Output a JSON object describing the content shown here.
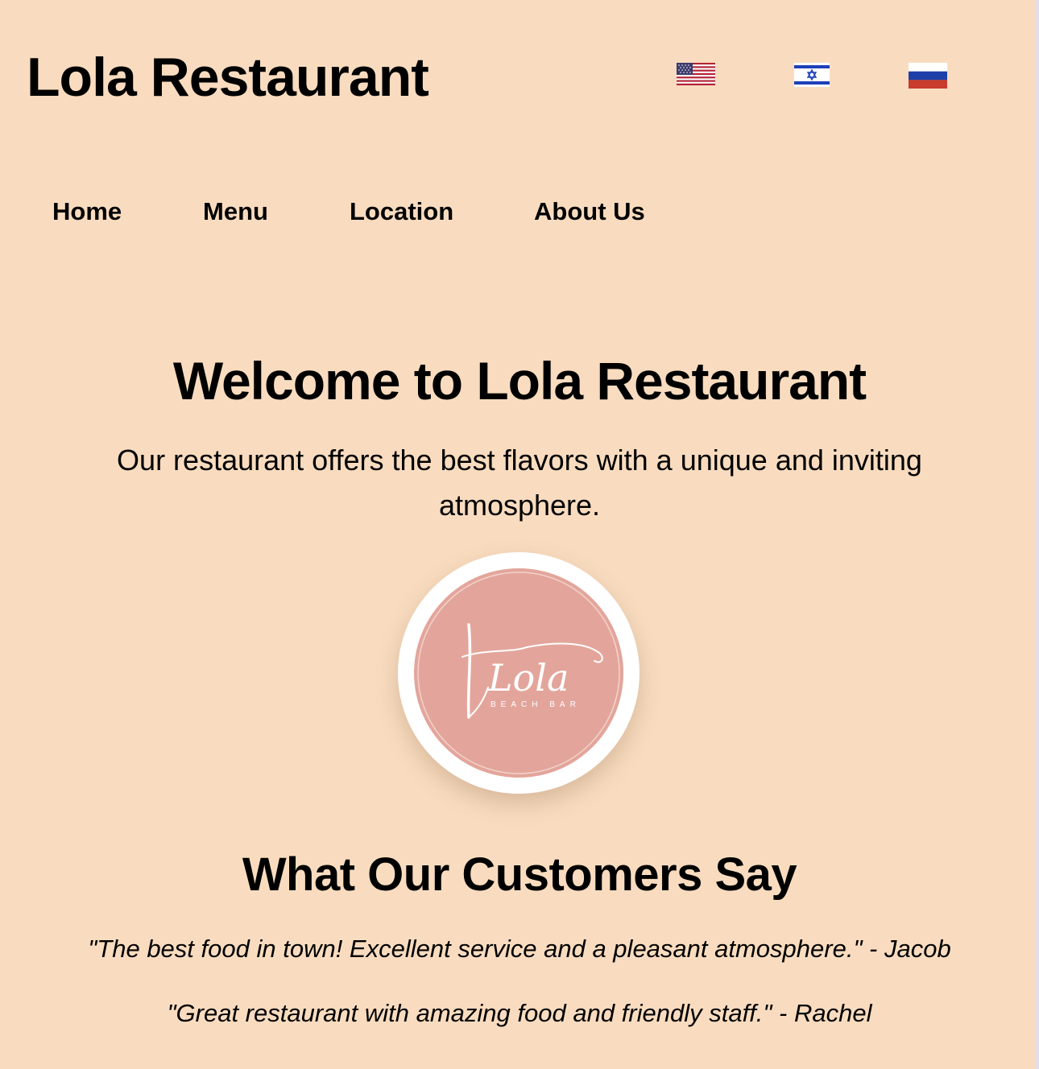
{
  "header": {
    "title": "Lola Restaurant",
    "languages": [
      {
        "code": "en",
        "icon": "us-flag-icon"
      },
      {
        "code": "he",
        "icon": "israel-flag-icon"
      },
      {
        "code": "ru",
        "icon": "russia-flag-icon"
      }
    ]
  },
  "nav": {
    "home": "Home",
    "menu": "Menu",
    "location": "Location",
    "about": "About Us"
  },
  "hero": {
    "title": "Welcome to Lola Restaurant",
    "text": "Our restaurant offers the best flavors with a unique and inviting atmosphere."
  },
  "logo": {
    "script_text": "Lola",
    "subtext": "BEACH BAR",
    "circle_color": "#e3a59b"
  },
  "reviews": {
    "title": "What Our Customers Say",
    "items": [
      "\"The best food in town! Excellent service and a pleasant atmosphere.\" - Jacob",
      "\"Great restaurant with amazing food and friendly staff.\" - Rachel"
    ]
  },
  "colors": {
    "background": "#f9dcbf",
    "text": "#000000"
  }
}
